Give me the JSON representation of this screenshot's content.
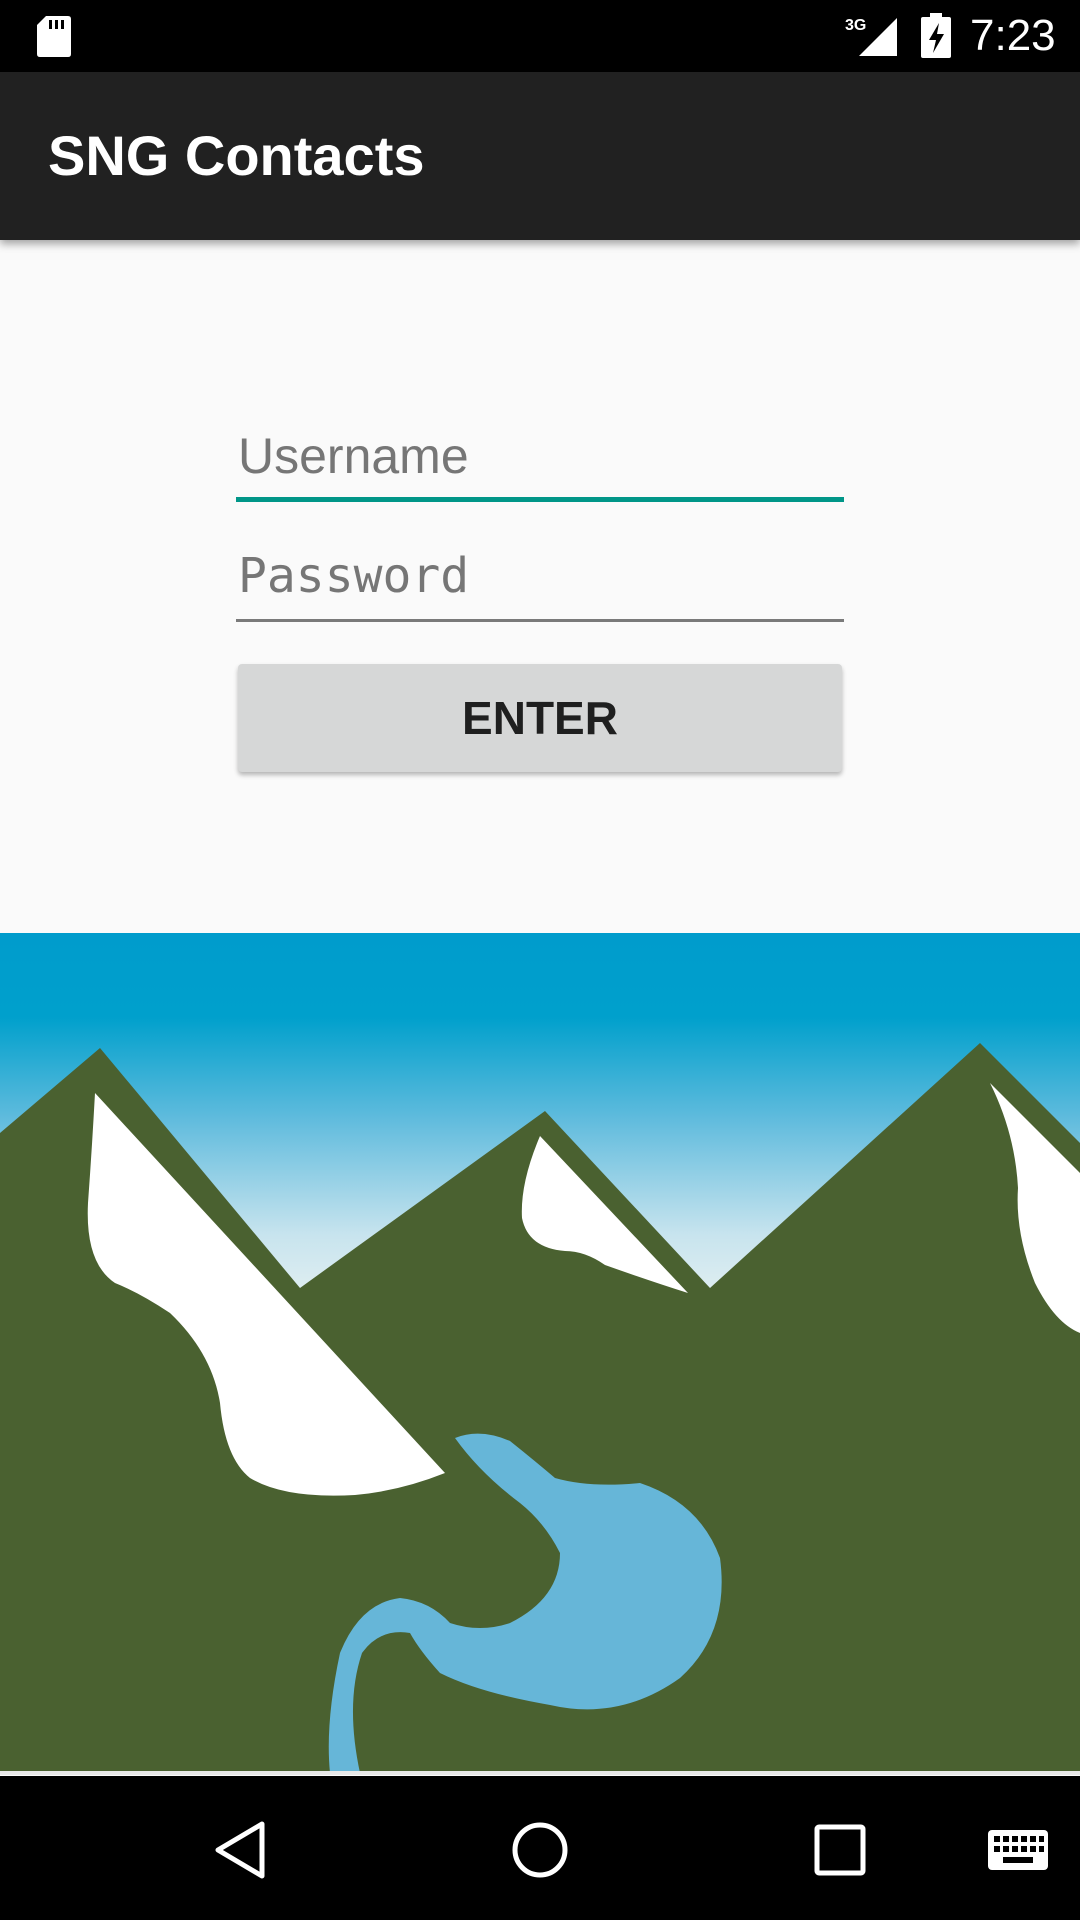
{
  "status_bar": {
    "time": "7:23",
    "network_label": "3G",
    "icons": [
      "sd-card-icon",
      "signal-icon",
      "battery-charging-icon"
    ]
  },
  "app_bar": {
    "title": "SNG Contacts"
  },
  "login_form": {
    "username_placeholder": "Username",
    "password_placeholder": "Password",
    "enter_label": "ENTER"
  },
  "colors": {
    "accent": "#009688",
    "app_bar": "#212121",
    "button": "#d6d7d7",
    "mountain_green": "#4a6130",
    "river_blue": "#66b6d8",
    "sky_top": "#009ccc"
  },
  "navigation_bar": {
    "icons": [
      "back-icon",
      "home-icon",
      "recents-icon",
      "keyboard-icon"
    ]
  }
}
